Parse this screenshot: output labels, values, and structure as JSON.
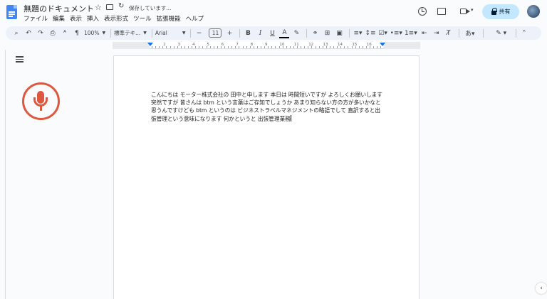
{
  "header": {
    "title": "無題のドキュメント",
    "status": "保存しています...",
    "menu": [
      "ファイル",
      "編集",
      "表示",
      "挿入",
      "表示形式",
      "ツール",
      "拡張機能",
      "ヘルプ"
    ],
    "share_label": "共有"
  },
  "toolbar": {
    "zoom": "100%",
    "style": "標準テキ...",
    "font": "Arial",
    "font_size": "11"
  },
  "ruler": {
    "numbers": [
      "2",
      "1",
      "1",
      "2",
      "3",
      "4",
      "5",
      "6",
      "7",
      "8",
      "9",
      "10",
      "11",
      "12",
      "13",
      "14",
      "15",
      "16",
      "17",
      "18"
    ]
  },
  "document": {
    "body": "こんにちは モーター株式会社の 田中と申します 本日は 時間短いですが よろしくお願いします 突然ですが 皆さんは btm という言葉はご存知でしょうか あまり知らない方の方が多いかなと思うんですけども btm というのは ビジネストラベルマネジメントの略語でして 直訳すると出張管理という意味になります 何かというと 出張管理業務"
  },
  "colors": {
    "accent": "#1a73e8",
    "share_bg": "#c2e7ff",
    "mic": "#de5840",
    "doc_icon": "#4285f4"
  }
}
